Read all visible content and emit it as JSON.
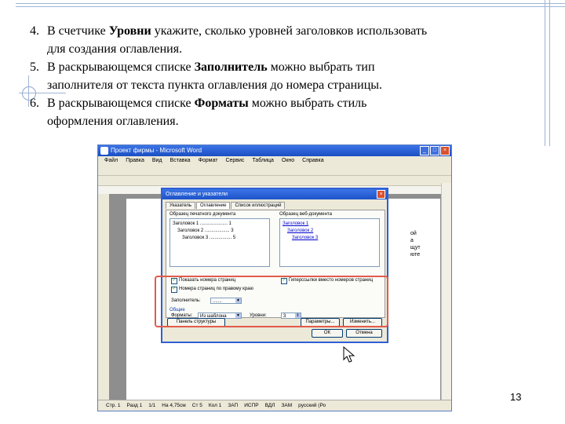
{
  "list": [
    {
      "num": "4.",
      "before": "В счетчике ",
      "bold": "Уровни",
      "after": " укажите, сколько уровней заголовков использовать",
      "cont": "для создания оглавления."
    },
    {
      "num": "5.",
      "before": "В раскрывающемся списке ",
      "bold": "Заполнитель",
      "after": " можно выбрать тип",
      "cont": "заполнителя от текста пункта оглавления до номера страницы."
    },
    {
      "num": "6.",
      "before": "В раскрывающемся списке ",
      "bold": "Форматы",
      "after": " можно выбрать стиль",
      "cont": "оформления оглавления."
    }
  ],
  "screenshot": {
    "window_title": "Проект фирмы - Microsoft Word",
    "menu": [
      "Файл",
      "Правка",
      "Вид",
      "Вставка",
      "Формат",
      "Сервис",
      "Таблица",
      "Окно",
      "Справка"
    ],
    "page_text": [
      "ой",
      "а",
      "щут",
      "юте"
    ],
    "status": [
      "Стр. 1",
      "Разд 1",
      "1/1",
      "На 4,75см",
      "Ст 5",
      "Кол 1",
      "ЗАП",
      "ИСПР",
      "ВДЛ",
      "ЗАМ",
      "русский (Ро"
    ],
    "dialog": {
      "title": "Оглавление и указатели",
      "tabs": [
        "Указатель",
        "Оглавление",
        "Список иллюстраций"
      ],
      "print_preview_label": "Образец печатного документа",
      "web_preview_label": "Образец веб-документа",
      "print_lines": [
        "Заголовок 1 ..................... 1",
        "Заголовок 2 ................... 3",
        "Заголовок 3 ................. 5"
      ],
      "web_lines": [
        "Заголовок 1",
        "Заголовок 2",
        "Заголовок 3"
      ],
      "chk_page_numbers": "Показать номера страниц",
      "chk_right_align": "Номера страниц по правому краю",
      "chk_hyperlinks": "Гиперссылки вместо номеров страниц",
      "leader_label": "Заполнитель:",
      "leader_value": ".......",
      "general_label": "Общие",
      "formats_label": "Форматы:",
      "formats_value": "Из шаблона",
      "levels_label": "Уровни:",
      "levels_value": "3",
      "panel_button": "Панель структуры",
      "options_button": "Параметры...",
      "modify_button": "Изменить...",
      "ok_button": "ОК",
      "cancel_button": "Отмена"
    }
  },
  "slide_number": "13"
}
